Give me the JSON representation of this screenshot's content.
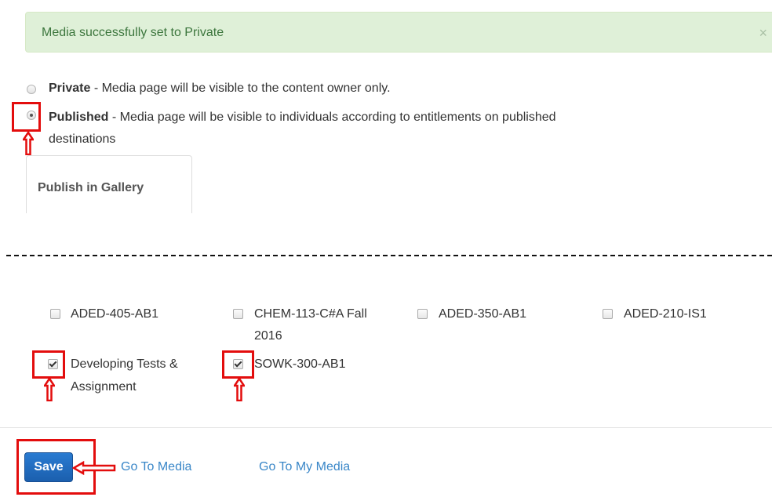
{
  "alert": {
    "message": "Media successfully set to Private",
    "close_glyph": "×"
  },
  "visibility": {
    "private": {
      "title": "Private",
      "desc": " - Media page will be visible to the content owner only.",
      "checked": false
    },
    "published": {
      "title": "Published",
      "desc": " - Media page will be visible to individuals according to entitlements on published",
      "desc2": "destinations",
      "checked": true
    }
  },
  "tabs": {
    "publish_in_gallery": "Publish in Gallery"
  },
  "courses": [
    {
      "label": "ADED-405-AB1",
      "checked": false
    },
    {
      "label": "CHEM-113-C#A Fall",
      "label2": "2016",
      "checked": false
    },
    {
      "label": "ADED-350-AB1",
      "checked": false
    },
    {
      "label": "ADED-210-IS1",
      "checked": false
    },
    {
      "label": "Developing Tests &",
      "label2": "Assignment",
      "checked": true
    },
    {
      "label": "SOWK-300-AB1",
      "checked": true
    }
  ],
  "actions": {
    "save": "Save",
    "go_to_media": "Go To Media",
    "go_to_my_media": "Go To My Media"
  },
  "annotation_color": "#e30d0d"
}
